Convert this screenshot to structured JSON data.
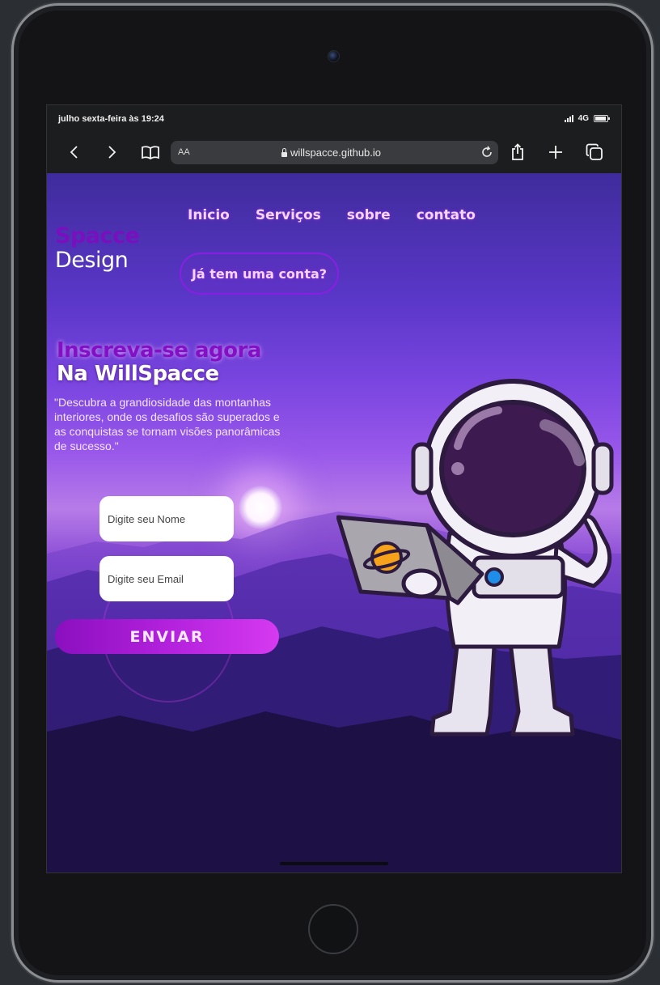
{
  "status_bar": {
    "time": "julho sexta-feira às 19:24",
    "network": "4G"
  },
  "browser": {
    "text_size_label": "AA",
    "url": "willspacce.github.io",
    "icons": [
      "back-icon",
      "forward-icon",
      "bookmarks-icon",
      "lock-icon",
      "reload-icon",
      "share-icon",
      "new-tab-icon",
      "tabs-icon"
    ]
  },
  "site": {
    "logo_line1": "Spacce",
    "logo_line2": "Design",
    "nav": [
      {
        "label": "Inicio"
      },
      {
        "label": "Serviços"
      },
      {
        "label": "sobre"
      },
      {
        "label": "contato"
      }
    ],
    "login_button": "Já tem uma conta?",
    "headline_line1": "Inscreva-se agora",
    "headline_line2": "Na WillSpacce",
    "description": "\"Descubra a grandiosidade das montanhas interiores, onde os desafios são superados e as conquistas se tornam visões panorâmicas de sucesso.\"",
    "form": {
      "name_placeholder": "Digite seu Nome",
      "email_placeholder": "Digite seu Email",
      "submit_label": "ENVIAR"
    }
  },
  "colors": {
    "accent": "#8a1fe3",
    "logo_purple": "#7a0fbf",
    "button_gradient_start": "#8a0fbf",
    "button_gradient_end": "#d53af0"
  }
}
